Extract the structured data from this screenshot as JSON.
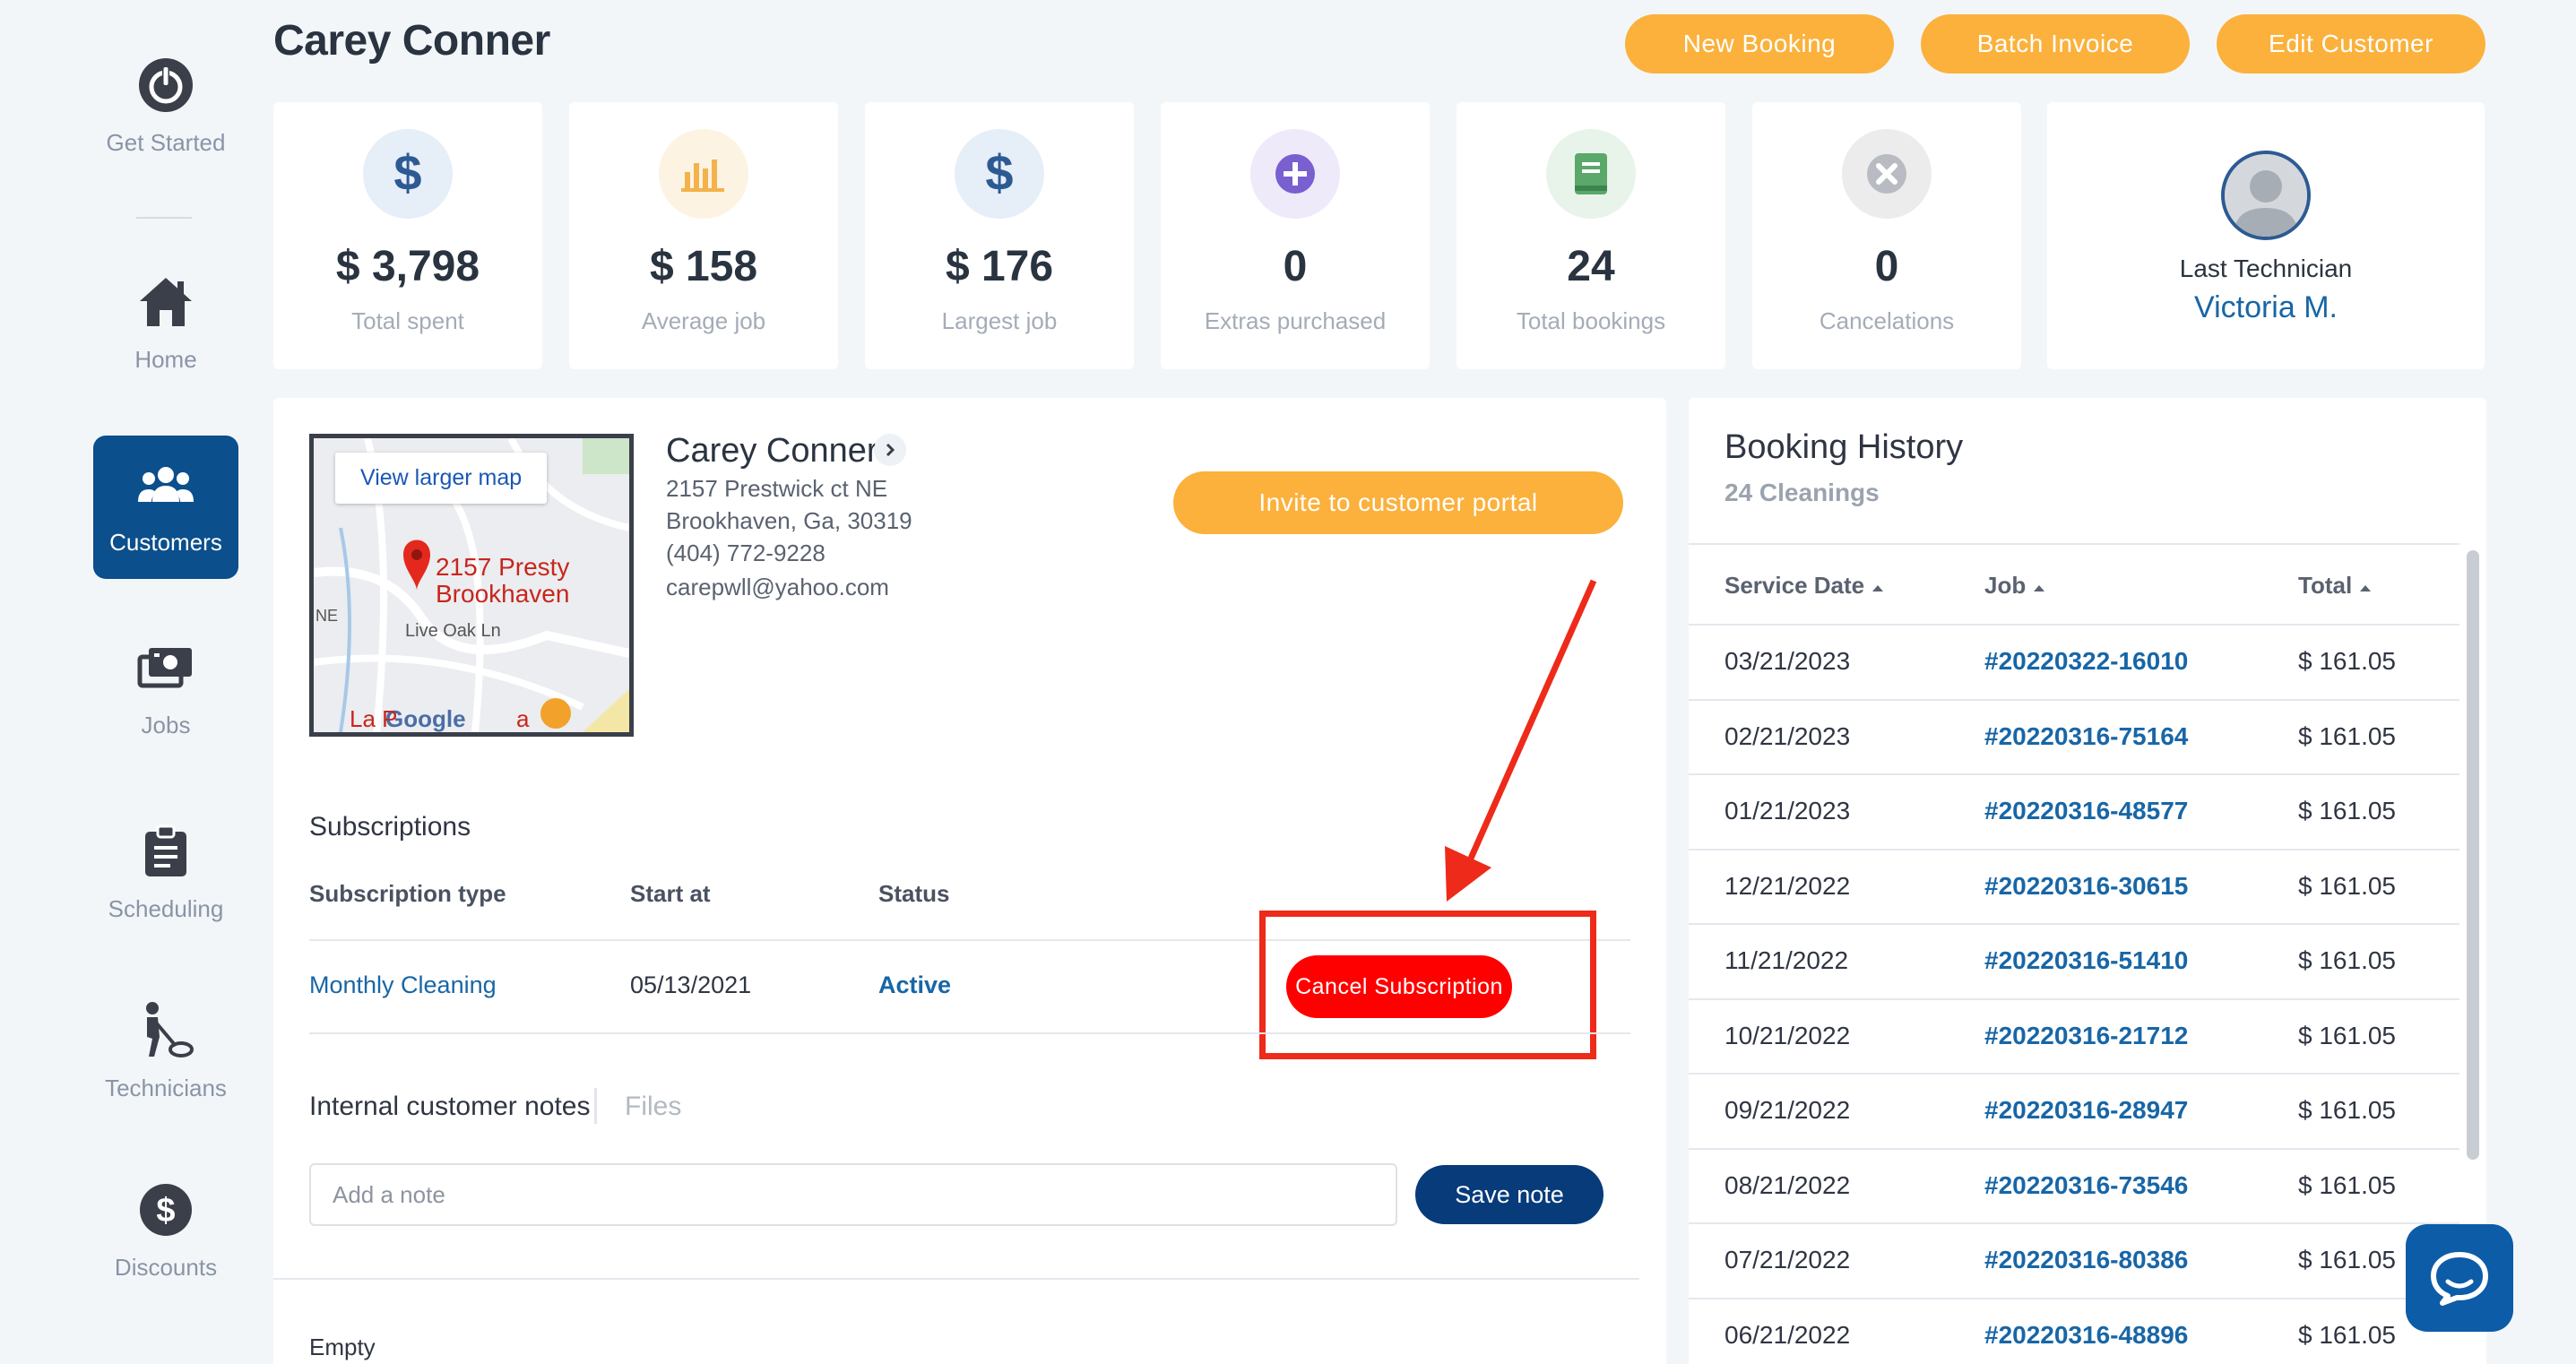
{
  "sidebar": {
    "items": [
      {
        "label": "Get Started",
        "icon": "power-icon"
      },
      {
        "label": "Home",
        "icon": "home-icon"
      },
      {
        "label": "Customers",
        "icon": "users-icon"
      },
      {
        "label": "Jobs",
        "icon": "money-stack-icon"
      },
      {
        "label": "Scheduling",
        "icon": "clipboard-icon"
      },
      {
        "label": "Technicians",
        "icon": "vacuum-person-icon"
      },
      {
        "label": "Discounts",
        "icon": "dollar-circle-icon"
      }
    ],
    "active": "Customers",
    "active_color": "#0b4f8c"
  },
  "header": {
    "title": "Carey Conner",
    "buttons": [
      "New Booking",
      "Batch Invoice",
      "Edit Customer"
    ],
    "button_color": "#fbb13c"
  },
  "stats": [
    {
      "value": "$ 3,798",
      "label": "Total spent",
      "icon": "dollar-icon"
    },
    {
      "value": "$ 158",
      "label": "Average job",
      "icon": "bar-chart-icon"
    },
    {
      "value": "$ 176",
      "label": "Largest job",
      "icon": "dollar-icon"
    },
    {
      "value": "0",
      "label": "Extras purchased",
      "icon": "plus-circle-icon"
    },
    {
      "value": "24",
      "label": "Total bookings",
      "icon": "book-icon"
    },
    {
      "value": "0",
      "label": "Cancelations",
      "icon": "x-circle-icon"
    }
  ],
  "technician": {
    "label": "Last Technician",
    "name": "Victoria M."
  },
  "customer": {
    "map_link": "View larger map",
    "map_labels": {
      "pin": "2157 Presty",
      "pin2": "Brookhaven",
      "street": "Live Oak Ln",
      "brand": "Google",
      "place": "La P",
      "place2": "a",
      "edge": "NE"
    },
    "name": "Carey Conner",
    "address1": "2157 Prestwick ct NE",
    "address2": "Brookhaven, Ga, 30319",
    "phone": "(404) 772-9228",
    "email": "carepwll@yahoo.com",
    "invite_label": "Invite to customer portal"
  },
  "subscriptions": {
    "title": "Subscriptions",
    "headers": [
      "Subscription type",
      "Start at",
      "Status"
    ],
    "rows": [
      {
        "type": "Monthly Cleaning",
        "start": "05/13/2021",
        "status": "Active",
        "action": "Cancel Subscription"
      }
    ],
    "highlight_color": "#ee2a1a"
  },
  "notes": {
    "tab_notes": "Internal customer notes",
    "tab_files": "Files",
    "placeholder": "Add a note",
    "save_label": "Save note",
    "empty_label": "Empty"
  },
  "booking_history": {
    "title": "Booking History",
    "subtitle": "24 Cleanings",
    "headers": [
      "Service Date",
      "Job",
      "Total"
    ],
    "rows": [
      {
        "date": "03/21/2023",
        "job": "#20220322-16010",
        "total": "$ 161.05"
      },
      {
        "date": "02/21/2023",
        "job": "#20220316-75164",
        "total": "$ 161.05"
      },
      {
        "date": "01/21/2023",
        "job": "#20220316-48577",
        "total": "$ 161.05"
      },
      {
        "date": "12/21/2022",
        "job": "#20220316-30615",
        "total": "$ 161.05"
      },
      {
        "date": "11/21/2022",
        "job": "#20220316-51410",
        "total": "$ 161.05"
      },
      {
        "date": "10/21/2022",
        "job": "#20220316-21712",
        "total": "$ 161.05"
      },
      {
        "date": "09/21/2022",
        "job": "#20220316-28947",
        "total": "$ 161.05"
      },
      {
        "date": "08/21/2022",
        "job": "#20220316-73546",
        "total": "$ 161.05"
      },
      {
        "date": "07/21/2022",
        "job": "#20220316-80386",
        "total": "$ 161.05"
      },
      {
        "date": "06/21/2022",
        "job": "#20220316-48896",
        "total": "$ 161.05"
      }
    ]
  },
  "chat": {
    "icon": "chat-bubble-icon"
  }
}
